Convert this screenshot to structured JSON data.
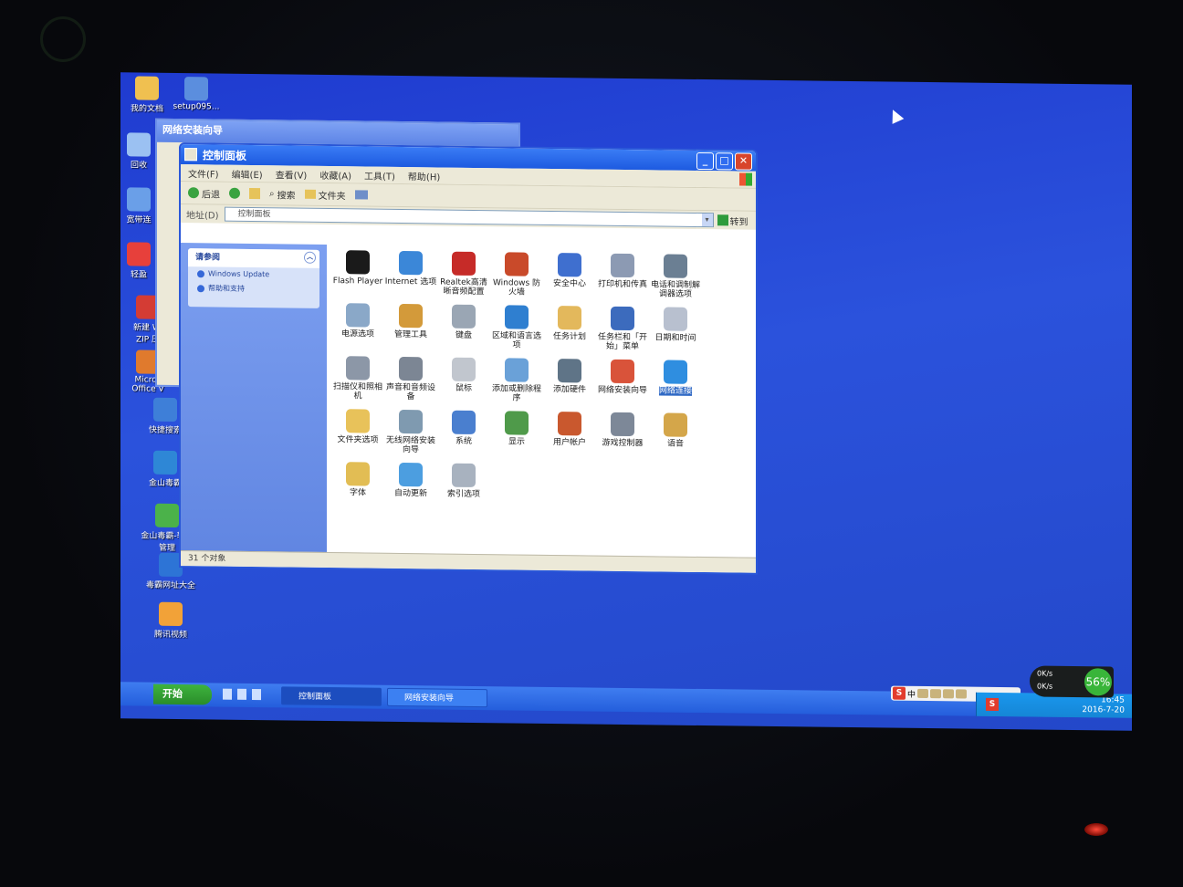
{
  "desktop": {
    "icons": [
      {
        "label": "我的文档",
        "color": "#f0c050"
      },
      {
        "label": "setup095...",
        "color": "#5b8ede"
      },
      {
        "label": "回收",
        "color": "#9bc1f2"
      },
      {
        "label": "宽带连",
        "color": "#6a9fe8"
      },
      {
        "label": "轻盈",
        "color": "#e7403b"
      },
      {
        "label": "新建 Wi ZIP 压",
        "color": "#d43c34"
      },
      {
        "label": "Micros Office V",
        "color": "#e07a2d"
      },
      {
        "label": "快捷搜索",
        "color": "#3e7fd8"
      },
      {
        "label": "金山毒霸",
        "color": "#2e87d6"
      },
      {
        "label": "金山毒霸-软件管理",
        "color": "#4bb24a"
      },
      {
        "label": "毒霸网址大全",
        "color": "#2d74d6"
      },
      {
        "label": "腾讯视频",
        "color": "#f2a238"
      }
    ]
  },
  "wizard": {
    "title": "网络安装向导"
  },
  "window": {
    "title": "控制面板",
    "menu": [
      "文件(F)",
      "编辑(E)",
      "查看(V)",
      "收藏(A)",
      "工具(T)",
      "帮助(H)"
    ],
    "toolbar": {
      "back": "后退",
      "search": "搜索",
      "folders": "文件夹"
    },
    "address": {
      "label": "地址(D)",
      "value": "控制面板",
      "go": "转到"
    },
    "see_also": {
      "title": "请参阅",
      "links": [
        "Windows Update",
        "帮助和支持"
      ]
    },
    "items": [
      {
        "label": "Flash Player",
        "color": "#1a1a1a"
      },
      {
        "label": "Internet 选项",
        "color": "#3b87d8"
      },
      {
        "label": "Realtek高清晰音频配置",
        "color": "#c62b28"
      },
      {
        "label": "Windows 防火墙",
        "color": "#c94a2a"
      },
      {
        "label": "安全中心",
        "color": "#3f6fcf"
      },
      {
        "label": "打印机和传真",
        "color": "#8c9ab3"
      },
      {
        "label": "电话和调制解调器选项",
        "color": "#6b7f93"
      },
      {
        "label": "电源选项",
        "color": "#8aa8c8"
      },
      {
        "label": "管理工具",
        "color": "#d39a3a"
      },
      {
        "label": "键盘",
        "color": "#9aa6b4"
      },
      {
        "label": "区域和语言选项",
        "color": "#2f7fd0"
      },
      {
        "label": "任务计划",
        "color": "#e3b85c"
      },
      {
        "label": "任务栏和「开始」菜单",
        "color": "#3c6bbd"
      },
      {
        "label": "日期和时间",
        "color": "#b8c0cf"
      },
      {
        "label": "扫描仪和照相机",
        "color": "#8c97a7"
      },
      {
        "label": "声音和音频设备",
        "color": "#7c8694"
      },
      {
        "label": "鼠标",
        "color": "#c1c6ce"
      },
      {
        "label": "添加或删除程序",
        "color": "#6aa1d8"
      },
      {
        "label": "添加硬件",
        "color": "#5f7487"
      },
      {
        "label": "网络安装向导",
        "color": "#d9533a"
      },
      {
        "label": "网络连接",
        "color": "#2f8ee0"
      },
      {
        "label": "文件夹选项",
        "color": "#e8c25a"
      },
      {
        "label": "无线网络安装向导",
        "color": "#7f9ab0"
      },
      {
        "label": "系统",
        "color": "#4a7fcf"
      },
      {
        "label": "显示",
        "color": "#4f9a4a"
      },
      {
        "label": "用户帐户",
        "color": "#c9582e"
      },
      {
        "label": "游戏控制器",
        "color": "#7d8898"
      },
      {
        "label": "语音",
        "color": "#d4a64a"
      },
      {
        "label": "字体",
        "color": "#e2bd54"
      },
      {
        "label": "自动更新",
        "color": "#4c9ee0"
      },
      {
        "label": "索引选项",
        "color": "#a8b2bf"
      }
    ],
    "selected_item": "网络连接",
    "status": "31 个对象"
  },
  "taskbar": {
    "start": "开始",
    "tasks": [
      "控制面板",
      "网络安装向导"
    ],
    "ime": "中",
    "clock_time": "16:45",
    "clock_date": "2016-7-20"
  },
  "net_monitor": {
    "up": "0K/s",
    "down": "0K/s",
    "percent": "56%"
  }
}
